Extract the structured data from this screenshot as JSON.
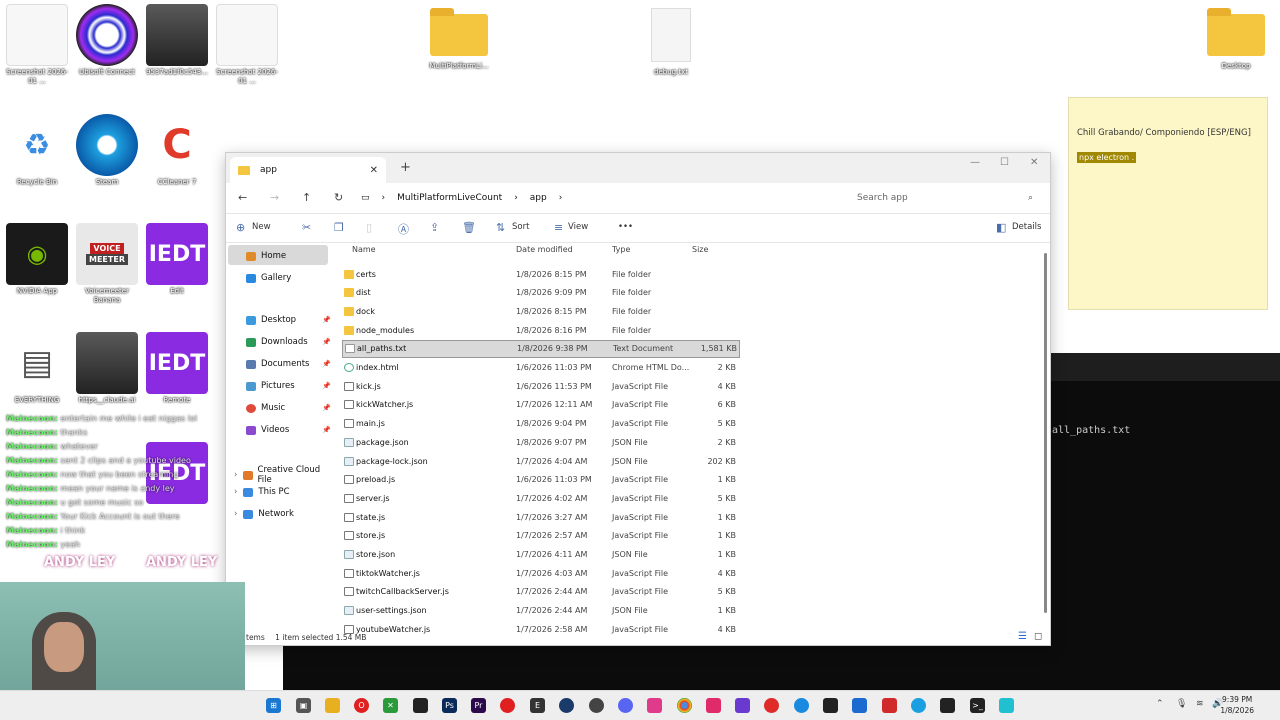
{
  "desktop": {
    "icons": [
      {
        "label": "Screenshot 2026-01 ..."
      },
      {
        "label": "Ubisoft Connect"
      },
      {
        "label": "9537ad1f0c543..."
      },
      {
        "label": "Screenshot 2026-01 ..."
      },
      {
        "label": "MultiPlatformLi..."
      },
      {
        "label": "debug.txt"
      },
      {
        "label": "Desktop"
      },
      {
        "label": "Recycle Bin"
      },
      {
        "label": "Steam"
      },
      {
        "label": "CCleaner 7"
      },
      {
        "label": "NVIDIA App"
      },
      {
        "label": "Voicemeeter Banana"
      },
      {
        "label": "Edit"
      },
      {
        "label": "EVERYTHING"
      },
      {
        "label": "https__claude.ai"
      },
      {
        "label": "Remote"
      }
    ],
    "voice_badge": "VOICE\nMEETER",
    "iedt_label": "IEDT"
  },
  "sticky": {
    "text": "Chill Grabando/ Componiendo [ESP/ENG]",
    "highlight": "npx electron ."
  },
  "terminal": {
    "line": "all_paths.txt"
  },
  "explorer": {
    "tab_title": "app",
    "breadcrumb": [
      "MultiPlatformLiveCount",
      "app"
    ],
    "search_placeholder": "Search app",
    "toolbar": {
      "new": "New",
      "sort": "Sort",
      "view": "View",
      "more": "•••",
      "details": "Details"
    },
    "nav": {
      "home": "Home",
      "gallery": "Gallery",
      "desktop": "Desktop",
      "downloads": "Downloads",
      "documents": "Documents",
      "pictures": "Pictures",
      "music": "Music",
      "videos": "Videos",
      "creative_cloud": "Creative Cloud File",
      "this_pc": "This PC",
      "network": "Network"
    },
    "columns": {
      "name": "Name",
      "date": "Date modified",
      "type": "Type",
      "size": "Size"
    },
    "files": [
      {
        "name": "certs",
        "date": "1/8/2026 8:15 PM",
        "type": "File folder",
        "size": "",
        "kind": "folder"
      },
      {
        "name": "dist",
        "date": "1/8/2026 9:09 PM",
        "type": "File folder",
        "size": "",
        "kind": "folder"
      },
      {
        "name": "dock",
        "date": "1/8/2026 8:15 PM",
        "type": "File folder",
        "size": "",
        "kind": "folder"
      },
      {
        "name": "node_modules",
        "date": "1/8/2026 8:16 PM",
        "type": "File folder",
        "size": "",
        "kind": "folder"
      },
      {
        "name": "all_paths.txt",
        "date": "1/8/2026 9:38 PM",
        "type": "Text Document",
        "size": "1,581 KB",
        "kind": "txt"
      },
      {
        "name": "index.html",
        "date": "1/6/2026 11:03 PM",
        "type": "Chrome HTML Do...",
        "size": "2 KB",
        "kind": "html"
      },
      {
        "name": "kick.js",
        "date": "1/6/2026 11:53 PM",
        "type": "JavaScript File",
        "size": "4 KB",
        "kind": "js"
      },
      {
        "name": "kickWatcher.js",
        "date": "1/7/2026 12:11 AM",
        "type": "JavaScript File",
        "size": "6 KB",
        "kind": "js"
      },
      {
        "name": "main.js",
        "date": "1/8/2026 9:04 PM",
        "type": "JavaScript File",
        "size": "5 KB",
        "kind": "js"
      },
      {
        "name": "package.json",
        "date": "1/8/2026 9:07 PM",
        "type": "JSON File",
        "size": "2 KB",
        "kind": "json"
      },
      {
        "name": "package-lock.json",
        "date": "1/7/2026 4:04 AM",
        "type": "JSON File",
        "size": "202 KB",
        "kind": "json"
      },
      {
        "name": "preload.js",
        "date": "1/6/2026 11:03 PM",
        "type": "JavaScript File",
        "size": "1 KB",
        "kind": "js"
      },
      {
        "name": "server.js",
        "date": "1/7/2026 4:02 AM",
        "type": "JavaScript File",
        "size": "5 KB",
        "kind": "js"
      },
      {
        "name": "state.js",
        "date": "1/7/2026 3:27 AM",
        "type": "JavaScript File",
        "size": "1 KB",
        "kind": "js"
      },
      {
        "name": "store.js",
        "date": "1/7/2026 2:57 AM",
        "type": "JavaScript File",
        "size": "1 KB",
        "kind": "js"
      },
      {
        "name": "store.json",
        "date": "1/7/2026 4:11 AM",
        "type": "JSON File",
        "size": "1 KB",
        "kind": "json"
      },
      {
        "name": "tiktokWatcher.js",
        "date": "1/7/2026 4:03 AM",
        "type": "JavaScript File",
        "size": "4 KB",
        "kind": "js"
      },
      {
        "name": "twitchCallbackServer.js",
        "date": "1/7/2026 2:44 AM",
        "type": "JavaScript File",
        "size": "5 KB",
        "kind": "js"
      },
      {
        "name": "user-settings.json",
        "date": "1/7/2026 2:44 AM",
        "type": "JSON File",
        "size": "1 KB",
        "kind": "json"
      },
      {
        "name": "youtubeWatcher.js",
        "date": "1/7/2026 2:58 AM",
        "type": "JavaScript File",
        "size": "4 KB",
        "kind": "js"
      }
    ],
    "status": {
      "items": "tems",
      "selected": "1 item selected  1.54 MB"
    }
  },
  "chat": [
    {
      "user": "Mainecoon:",
      "msg": "entertain me while i eat niggas lol"
    },
    {
      "user": "Mainecoon:",
      "msg": "thanks"
    },
    {
      "user": "Mainecoon:",
      "msg": "whatever"
    },
    {
      "user": "Mainecoon:",
      "msg": "sent 2 clips and a youtube video"
    },
    {
      "user": "Mainecoon:",
      "msg": "now that you been streaming"
    },
    {
      "user": "Mainecoon:",
      "msg": "mean your name is andy ley"
    },
    {
      "user": "Mainecoon:",
      "msg": "u got some music so"
    },
    {
      "user": "Mainecoon:",
      "msg": "Your Kick Account is out there"
    },
    {
      "user": "Mainecoon:",
      "msg": "i think"
    },
    {
      "user": "Mainecoon:",
      "msg": "yeah"
    }
  ],
  "banner": "ANDY LEY",
  "taskbar": {
    "time": "9:39 PM",
    "date": "1/8/2026"
  }
}
